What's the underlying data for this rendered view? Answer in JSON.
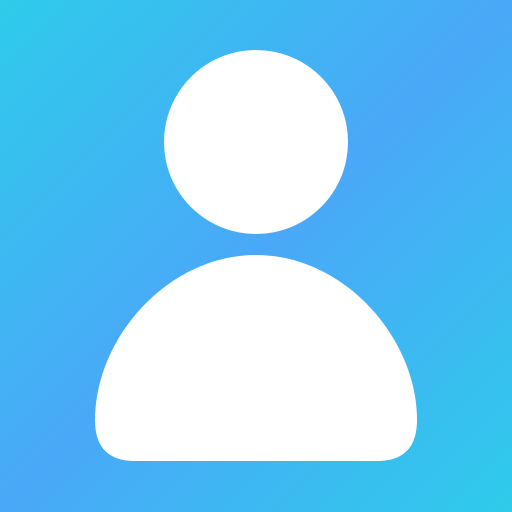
{
  "avatar": {
    "icon": "user-icon",
    "gradient_top_left": "#2ECBEA",
    "gradient_middle": "#4AA8F8",
    "gradient_bottom_right": "#2ECBEA",
    "figure_color": "#FFFFFF"
  }
}
